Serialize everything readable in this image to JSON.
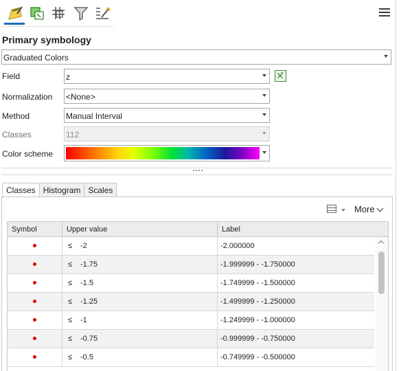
{
  "toolbar": {
    "icons": [
      "primary-symbology-icon",
      "vary-symbology-icon",
      "symbol-layers-icon",
      "filter-icon",
      "advanced-symbology-icon",
      "menu-icon"
    ],
    "active_icon": "primary-symbology-icon",
    "accent_color": "#1f6fb5"
  },
  "primary_symbology": {
    "section_title": "Primary symbology",
    "renderer": "Graduated Colors"
  },
  "form": {
    "field_label": "Field",
    "field_value": "z",
    "normalization_label": "Normalization",
    "normalization_value": "<None>",
    "method_label": "Method",
    "method_value": "Manual Interval",
    "classes_label": "Classes",
    "classes_value": "112",
    "color_scheme_label": "Color scheme",
    "color_scheme_colors": [
      "#ff0000",
      "#ff6a00",
      "#ffd500",
      "#7cff00",
      "#00e23a",
      "#00b7a8",
      "#0066c8",
      "#1a1a9a",
      "#8a00c8",
      "#ff00ff"
    ]
  },
  "tabs": [
    {
      "label": "Classes",
      "active": true
    },
    {
      "label": "Histogram",
      "active": false
    },
    {
      "label": "Scales",
      "active": false
    }
  ],
  "classes_panel": {
    "more_label": "More",
    "columns": {
      "symbol": "Symbol",
      "upper": "Upper value",
      "label": "Label"
    },
    "symbol_color": "#e00000",
    "rows": [
      {
        "op": "≤",
        "upper": "-2",
        "label": "-2.000000"
      },
      {
        "op": "≤",
        "upper": "-1.75",
        "label": "-1.999999 - -1.750000"
      },
      {
        "op": "≤",
        "upper": "-1.5",
        "label": "-1.749999 - -1.500000"
      },
      {
        "op": "≤",
        "upper": "-1.25",
        "label": "-1.499999 - -1.250000"
      },
      {
        "op": "≤",
        "upper": "-1",
        "label": "-1.249999 - -1.000000"
      },
      {
        "op": "≤",
        "upper": "-0.75",
        "label": "-0.999999 - -0.750000"
      },
      {
        "op": "≤",
        "upper": "-0.5",
        "label": "-0.749999 - -0.500000"
      }
    ]
  }
}
